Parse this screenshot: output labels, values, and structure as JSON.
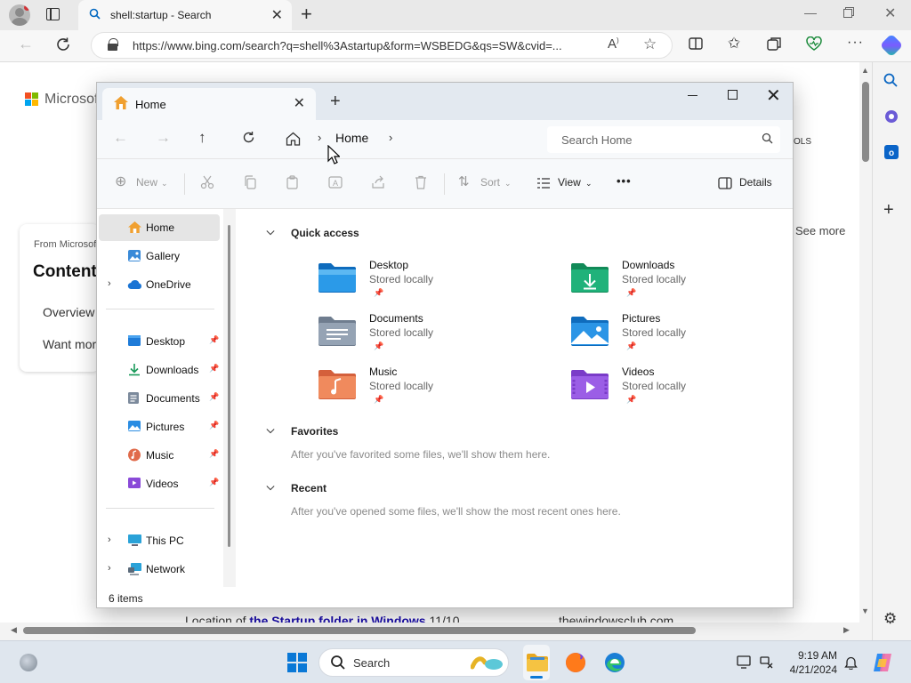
{
  "browser": {
    "tab_title": "shell:startup - Search",
    "url": "https://www.bing.com/search?q=shell%3Astartup&form=WSBEDG&qs=SW&cvid=..."
  },
  "webpage": {
    "brand": "Microsoft",
    "card_from": "From Microsoft",
    "card_title": "Content",
    "card_line1": "Overview",
    "card_line2": "Want more",
    "tools_fragment": "OLS",
    "see_more": "See more",
    "result_text": "Location of ",
    "result_bold": "the Startup folder in Windows",
    "result_suffix": " 11/10",
    "result_source": "thewindowsclub.com"
  },
  "explorer": {
    "tab_title": "Home",
    "breadcrumb": "Home",
    "search_placeholder": "Search Home",
    "commands": {
      "new": "New",
      "sort": "Sort",
      "view": "View",
      "more": "•••",
      "details": "Details"
    },
    "nav_pane": [
      {
        "label": "Home"
      },
      {
        "label": "Gallery"
      },
      {
        "label": "OneDrive"
      },
      {
        "label": "Desktop"
      },
      {
        "label": "Downloads"
      },
      {
        "label": "Documents"
      },
      {
        "label": "Pictures"
      },
      {
        "label": "Music"
      },
      {
        "label": "Videos"
      },
      {
        "label": "This PC"
      },
      {
        "label": "Network"
      }
    ],
    "status": "6 items",
    "sections": {
      "quick_access": "Quick access",
      "favorites": "Favorites",
      "favorites_empty": "After you've favorited some files, we'll show them here.",
      "recent": "Recent",
      "recent_empty": "After you've opened some files, we'll show the most recent ones here."
    },
    "quick_access": [
      {
        "name": "Desktop",
        "sub": "Stored locally"
      },
      {
        "name": "Downloads",
        "sub": "Stored locally"
      },
      {
        "name": "Documents",
        "sub": "Stored locally"
      },
      {
        "name": "Pictures",
        "sub": "Stored locally"
      },
      {
        "name": "Music",
        "sub": "Stored locally"
      },
      {
        "name": "Videos",
        "sub": "Stored locally"
      }
    ]
  },
  "taskbar": {
    "search_label": "Search",
    "time": "9:19 AM",
    "date": "4/21/2024"
  },
  "colors": {
    "accent": "#0a78d6",
    "folder_yellow": "#f5c342",
    "selection": "#e5e5e5"
  }
}
